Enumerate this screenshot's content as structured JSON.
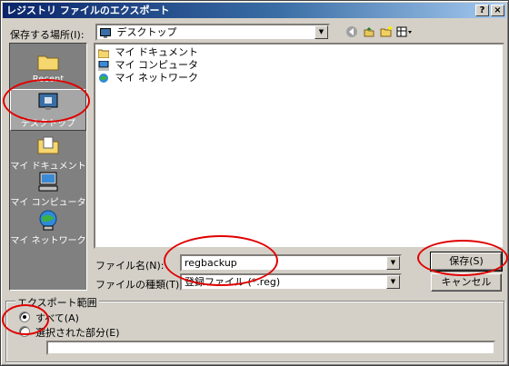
{
  "window": {
    "title": "レジストリ ファイルのエクスポート",
    "help_btn": "?",
    "close_btn": "×"
  },
  "location": {
    "label": "保存する場所(I):",
    "value": "デスクトップ"
  },
  "toolbar": {
    "back": "back-icon",
    "up": "up-folder-icon",
    "new_folder": "new-folder-icon",
    "view": "view-menu-icon"
  },
  "places": [
    {
      "label": "Recent",
      "icon": "recent-folder-icon"
    },
    {
      "label": "デスクトップ",
      "icon": "desktop-icon"
    },
    {
      "label": "マイ ドキュメント",
      "icon": "my-documents-icon"
    },
    {
      "label": "マイ コンピュータ",
      "icon": "my-computer-icon"
    },
    {
      "label": "マイ ネットワーク",
      "icon": "my-network-icon"
    }
  ],
  "files": [
    {
      "name": "マイ ドキュメント",
      "icon": "my-documents-icon"
    },
    {
      "name": "マイ コンピュータ",
      "icon": "my-computer-icon"
    },
    {
      "name": "マイ ネットワーク",
      "icon": "my-network-icon"
    }
  ],
  "filename": {
    "label": "ファイル名(N):",
    "value": "regbackup"
  },
  "filetype": {
    "label": "ファイルの種類(T):",
    "value": "登録ファイル (*.reg)"
  },
  "buttons": {
    "save": "保存(S)",
    "cancel": "キャンセル"
  },
  "export_range": {
    "legend": "エクスポート範囲",
    "all": "すべて(A)",
    "selected": "選択された部分(E)",
    "selected_value": "",
    "selected_option": "all"
  },
  "colors": {
    "annotation": "#e00000",
    "titlebar_start": "#0a246a",
    "titlebar_end": "#a6caf0"
  }
}
